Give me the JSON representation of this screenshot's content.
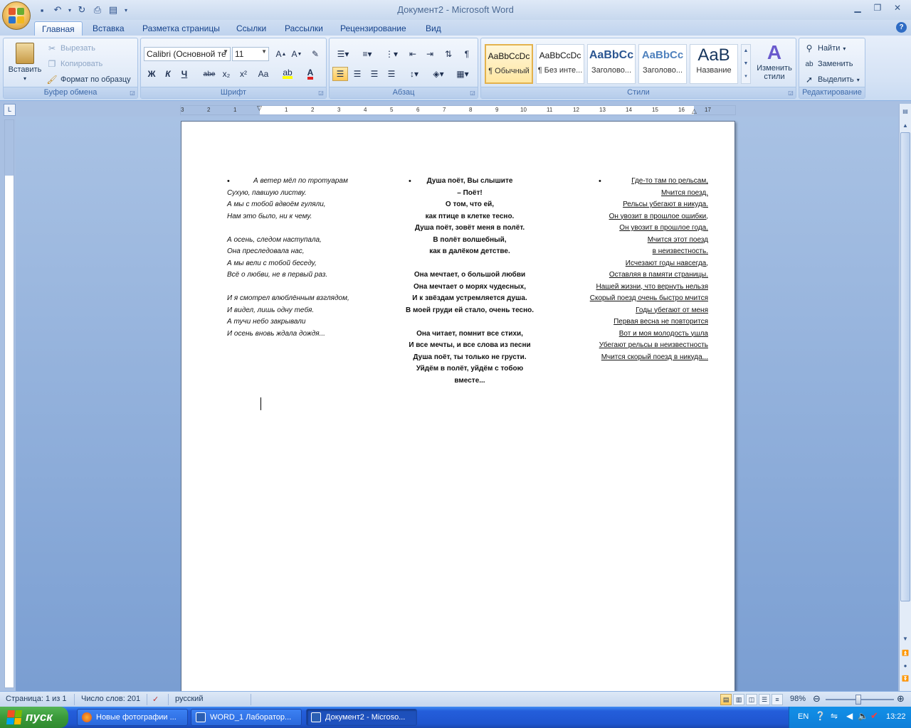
{
  "window": {
    "title": "Документ2 - Microsoft Word"
  },
  "tabs": [
    "Главная",
    "Вставка",
    "Разметка страницы",
    "Ссылки",
    "Рассылки",
    "Рецензирование",
    "Вид"
  ],
  "clipboard": {
    "paste": "Вставить",
    "cut": "Вырезать",
    "copy": "Копировать",
    "format_painter": "Формат по образцу",
    "label": "Буфер обмена"
  },
  "font": {
    "name": "Calibri (Основной те",
    "size": "11",
    "label": "Шрифт",
    "bold": "Ж",
    "italic": "К",
    "underline": "Ч",
    "strike": "abe",
    "sub": "x₂",
    "sup": "x²",
    "case": "Aa"
  },
  "paragraph": {
    "label": "Абзац"
  },
  "styles": {
    "label": "Стили",
    "items": [
      {
        "sample": "AaBbCcDc",
        "name": "¶ Обычный"
      },
      {
        "sample": "AaBbCcDc",
        "name": "¶ Без инте..."
      },
      {
        "sample": "AaBbCc",
        "name": "Заголово..."
      },
      {
        "sample": "AaBbCc",
        "name": "Заголово..."
      },
      {
        "sample": "AaB",
        "name": "Название"
      }
    ],
    "change_styles": "Изменить стили"
  },
  "editing": {
    "label": "Редактирование",
    "find": "Найти",
    "replace": "Заменить",
    "select": "Выделить"
  },
  "document": {
    "col1": [
      "А ветер мёл по тротуарам",
      "Сухую, павшую листву.",
      "А мы с тобой вдвоём гуляли,",
      "Нам это было, ни к чему.",
      "",
      "А осень, следом наступала,",
      "Она преследовала нас,",
      "А мы вели с тобой беседу,",
      "Всё о любви, не в первый раз.",
      "",
      "И я смотрел влюблённым взглядом,",
      "И видел, лишь одну тебя.",
      "А тучи небо закрывали",
      "И осень вновь ждала дождя..."
    ],
    "col2": [
      "Душа поёт, Вы слышите",
      "– Поёт!",
      "О том, что ей,",
      "как птице в клетке тесно.",
      "Душа поёт, зовёт меня в полёт.",
      "В полёт волшебный,",
      "как в далёком детстве.",
      "",
      "Она мечтает, о большой любви",
      "Она мечтает о морях чудесных,",
      "И к звёздам устремляется душа.",
      "В моей груди ей стало, очень тесно.",
      "",
      "Она читает, помнит все стихи,",
      "И все мечты, и все слова из песни",
      "Душа поёт, ты только не грусти.",
      "Уйдём в полёт, уйдём с тобою",
      "вместе..."
    ],
    "col3": [
      "Где-то там по рельсам,",
      "Мчится поезд.",
      "Рельсы убегают в никуда.",
      "Он увозит в прошлое ошибки,",
      "Он увозит в прошлое года.",
      "Мчится этот поезд",
      "в неизвестность.",
      "Исчезают годы навсегда,",
      "Оставляя в памяти страницы.",
      "Нашей жизни, что вернуть нельзя",
      "Скорый поезд очень быстро мчится",
      "Годы убегают от меня",
      "Первая весна не повторится",
      "Вот и моя молодость ушла",
      "Убегают рельсы в неизвестность",
      "Мчится скорый поезд в никуда..."
    ]
  },
  "statusbar": {
    "page": "Страница: 1 из 1",
    "words": "Число слов: 201",
    "language": "русский",
    "zoom": "98%"
  },
  "taskbar": {
    "start": "пуск",
    "tasks": [
      "Новые фотографии ...",
      "WORD_1 Лаборатор...",
      "Документ2 - Microso..."
    ],
    "lang": "EN",
    "clock": "13:22"
  },
  "colors": {
    "accent": "#15428b",
    "ribbon_bg": "#d4e2f5",
    "taskbar": "#245edb"
  }
}
